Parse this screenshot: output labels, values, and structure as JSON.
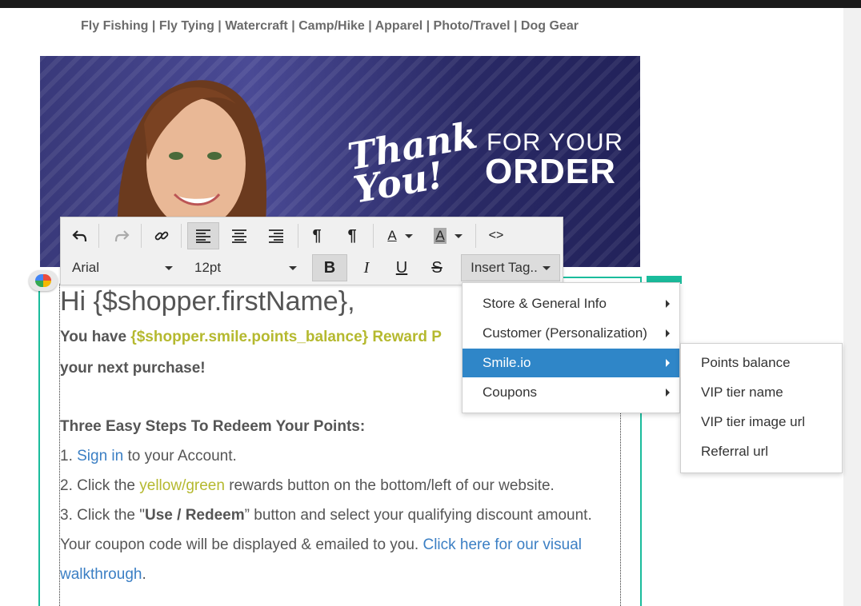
{
  "nav": {
    "categories": "Fly Fishing | Fly Tying | Watercraft | Camp/Hike | Apparel | Photo/Travel | Dog Gear"
  },
  "banner": {
    "thank_you": "Thank You!",
    "for_your": "FOR YOUR",
    "order": "ORDER"
  },
  "toolbar": {
    "font_family": "Arial",
    "font_size": "12pt",
    "insert_tag_label": "Insert Tag..",
    "icons": [
      "undo-icon",
      "redo-icon",
      "link-icon",
      "align-left-icon",
      "align-center-icon",
      "align-right-icon",
      "ltr-icon",
      "rtl-icon",
      "text-color-icon",
      "background-color-icon",
      "source-code-icon",
      "bold-icon",
      "italic-icon",
      "underline-icon",
      "strikethrough-icon"
    ]
  },
  "email": {
    "greeting": "Hi {$shopper.firstName},",
    "line1_prefix": "You have ",
    "line1_var": "{$shopper.smile.points_balance} Reward P",
    "line2": "your next purchase!",
    "steps_heading": "Three Easy Steps To Redeem Your Points:",
    "step1_num": "1. ",
    "step1_link": "Sign in",
    "step1_rest": " to your Account.",
    "step2_prefix": "2. Click the ",
    "step2_highlight": "yellow/green",
    "step2_rest": " rewards button on the bottom/left of our website.",
    "step3_prefix": "3. Click the \"",
    "step3_bold": "Use / Redeem",
    "step3_rest": "” button and select your qualifying discount amount.",
    "coupon_text": "Your coupon code will be displayed & emailed to you. ",
    "coupon_link1": "Click here for our visual",
    "coupon_link2": "walkthrough",
    "coupon_end": "."
  },
  "insert_menu": {
    "items": [
      "Store & General Info",
      "Customer (Personalization)",
      "Smile.io",
      "Coupons"
    ],
    "highlighted": "Smile.io"
  },
  "smile_submenu": {
    "items": [
      "Points balance",
      "VIP tier name",
      "VIP tier image url",
      "Referral url"
    ]
  },
  "colors": {
    "accent_teal": "#1abc9c",
    "menu_highlight": "#2f86c8",
    "olive_text": "#b5b92f",
    "link_blue": "#3b7fc4"
  }
}
